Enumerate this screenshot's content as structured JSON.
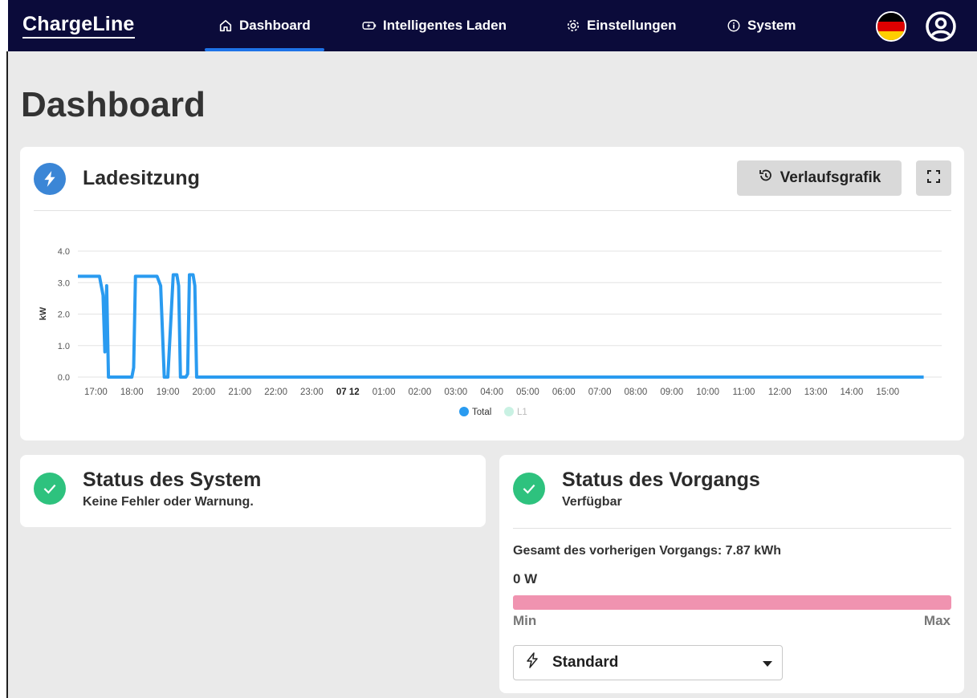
{
  "brand": "ChargeLine",
  "nav": [
    {
      "label": "Dashboard",
      "icon": "home-icon",
      "active": true
    },
    {
      "label": "Intelligentes Laden",
      "icon": "battery-charging-icon",
      "active": false
    },
    {
      "label": "Einstellungen",
      "icon": "gear-icon",
      "active": false
    },
    {
      "label": "System",
      "icon": "info-icon",
      "active": false
    }
  ],
  "language_flag": "flag-de-icon",
  "page_title": "Dashboard",
  "session_card": {
    "title": "Ladesitzung",
    "history_button": "Verlaufsgrafik",
    "fullscreen_icon": "fullscreen-icon"
  },
  "chart_data": {
    "type": "line",
    "ylabel": "kW",
    "xlabel": "",
    "ylim": [
      0,
      4
    ],
    "yticks": [
      "4.0",
      "3.0",
      "2.0",
      "1.0",
      "0.0"
    ],
    "xticks": [
      "17:00",
      "18:00",
      "19:00",
      "20:00",
      "21:00",
      "22:00",
      "23:00",
      "07 12",
      "01:00",
      "02:00",
      "03:00",
      "04:00",
      "05:00",
      "06:00",
      "07:00",
      "08:00",
      "09:00",
      "10:00",
      "11:00",
      "12:00",
      "13:00",
      "14:00",
      "15:00"
    ],
    "grid": true,
    "legend_position": "bottom",
    "series": [
      {
        "name": "Total",
        "color": "#2a9bf0",
        "x_hours": [
          16.5,
          17.1,
          17.2,
          17.25,
          17.3,
          17.35,
          17.4,
          17.5,
          18.0,
          18.05,
          18.1,
          18.7,
          18.8,
          18.9,
          19.0,
          19.15,
          19.25,
          19.3,
          19.35,
          19.5,
          19.55,
          19.6,
          19.7,
          19.75,
          19.8,
          19.9,
          19.95,
          20.0,
          40.0
        ],
        "values": [
          3.2,
          3.2,
          2.6,
          0.8,
          2.9,
          0.0,
          0.0,
          0.0,
          0.0,
          0.3,
          3.2,
          3.2,
          2.9,
          0.0,
          0.0,
          3.25,
          3.25,
          2.9,
          0.0,
          0.0,
          0.1,
          3.25,
          3.25,
          2.9,
          0.0,
          0.0,
          0.0,
          0.0,
          0.0
        ]
      },
      {
        "name": "L1",
        "color": "#c9f1e3",
        "values": []
      }
    ]
  },
  "system_status": {
    "title": "Status des System",
    "subtitle": "Keine Fehler oder Warnung."
  },
  "operation_status": {
    "title": "Status des Vorgangs",
    "subtitle": "Verfügbar",
    "previous_total": "Gesamt des vorherigen Vorgangs: 7.87 kWh",
    "power": "0 W",
    "power_level": 0,
    "min_label": "Min",
    "max_label": "Max",
    "mode": "Standard"
  }
}
